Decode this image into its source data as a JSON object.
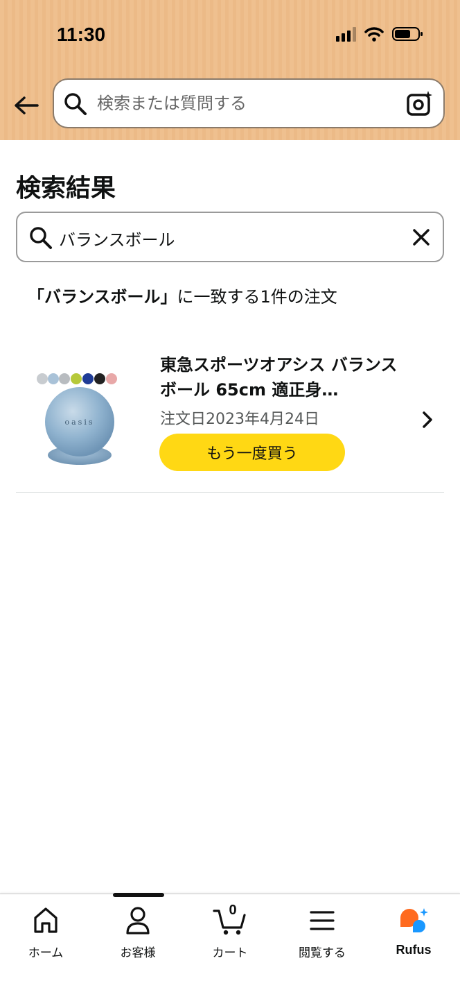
{
  "status_bar": {
    "time": "11:30"
  },
  "top_search": {
    "placeholder": "検索または質問する"
  },
  "page": {
    "title": "検索結果",
    "search_value": "バランスボール",
    "summary_query": "「バランスボール」",
    "summary_rest": "に一致する1件の注文"
  },
  "orders": [
    {
      "title": "東急スポーツオアシス バランスボール 65cm 適正身…",
      "date": "注文日2023年4月24日",
      "buy_again_label": "もう一度買う",
      "image_brand_text": "oasis"
    }
  ],
  "bottom_nav": {
    "items": [
      {
        "label": "ホーム",
        "icon": "home-icon"
      },
      {
        "label": "お客様",
        "icon": "person-icon"
      },
      {
        "label": "カート",
        "icon": "cart-icon"
      },
      {
        "label": "閲覧する",
        "icon": "menu-icon"
      },
      {
        "label": "Rufus",
        "icon": "rufus-icon"
      }
    ],
    "cart_count": "0"
  },
  "colors": {
    "header_bg": "#efc08f",
    "buy_again": "#ffd814",
    "rufus_orange": "#ff6a1f",
    "rufus_blue": "#1a98ff"
  }
}
